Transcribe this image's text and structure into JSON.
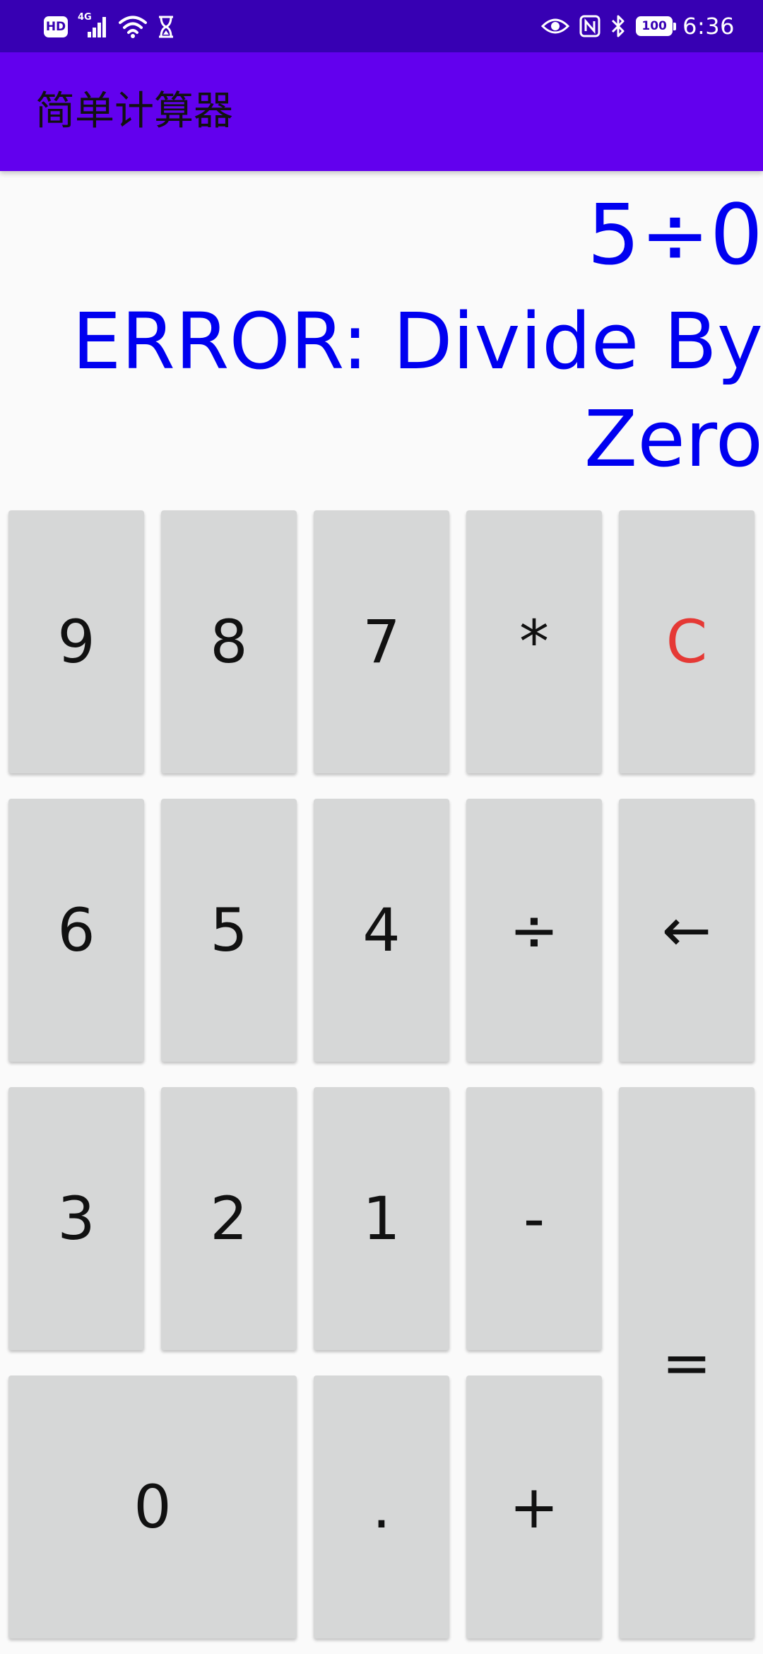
{
  "status_bar": {
    "hd_label": "HD",
    "network_label": "4G",
    "battery": "100",
    "time": "6:36",
    "icons": [
      "hd-icon",
      "signal-icon",
      "wifi-icon",
      "hourglass-icon",
      "eye-icon",
      "nfc-icon",
      "bluetooth-icon",
      "battery-icon"
    ]
  },
  "app_bar": {
    "title": "简单计算器",
    "color": "#6200ee"
  },
  "display": {
    "expression": "5÷0",
    "result": "ERROR: Divide By Zero",
    "text_color": "#0000f0"
  },
  "keypad": {
    "row1": [
      "9",
      "8",
      "7",
      "*",
      "C"
    ],
    "row2": [
      "6",
      "5",
      "4",
      "÷",
      "←"
    ],
    "row3": [
      "3",
      "2",
      "1",
      "-"
    ],
    "row4": [
      "0",
      ".",
      "+"
    ],
    "equals": "=",
    "key_color": "#d6d7d7",
    "clear_color": "#e53935"
  }
}
